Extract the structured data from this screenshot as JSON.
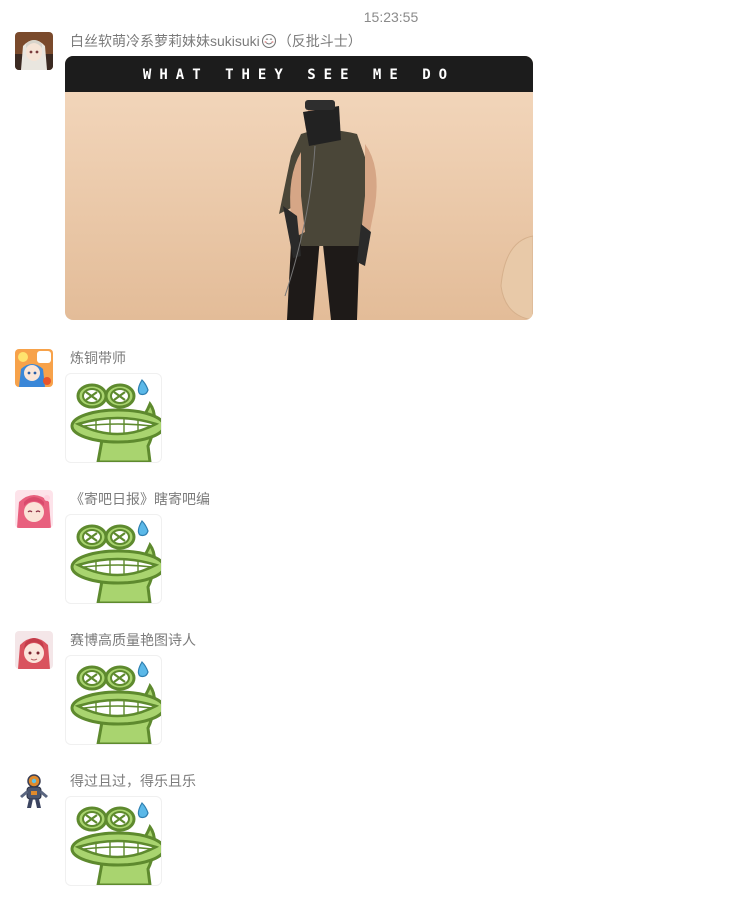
{
  "chat": {
    "timestamp": "15:23:55",
    "messages": [
      {
        "sender": "白丝软萌冷系萝莉妹妹sukisuki",
        "sender_suffix": "（反批斗士）",
        "sender_emoji": "smiling-face-emoji",
        "content_type": "gif",
        "gif_caption": "WHAT THEY SEE ME DO",
        "avatar": "anime-girl-white-hair-avatar"
      },
      {
        "sender": "炼铜带师",
        "content_type": "sticker",
        "sticker": "frog-grimace-sweat-sticker",
        "avatar": "anime-girl-blue-hair-avatar"
      },
      {
        "sender": "《寄吧日报》瞎寄吧编",
        "content_type": "sticker",
        "sticker": "frog-grimace-sweat-sticker",
        "avatar": "anime-girl-pink-hair-avatar"
      },
      {
        "sender": "赛博高质量艳图诗人",
        "content_type": "sticker",
        "sticker": "frog-grimace-sweat-sticker",
        "avatar": "anime-girl-red-hair-avatar"
      },
      {
        "sender": "得过且过，得乐且乐",
        "content_type": "sticker",
        "sticker": "frog-grimace-sweat-sticker",
        "avatar": "robot-character-avatar"
      }
    ]
  },
  "colors": {
    "sender_text": "#7b7b7b",
    "timestamp_text": "#8a8a8a",
    "frog_green": "#a9d46f",
    "frog_outline": "#5e8a2e",
    "sweat_blue": "#5bb8e8"
  }
}
